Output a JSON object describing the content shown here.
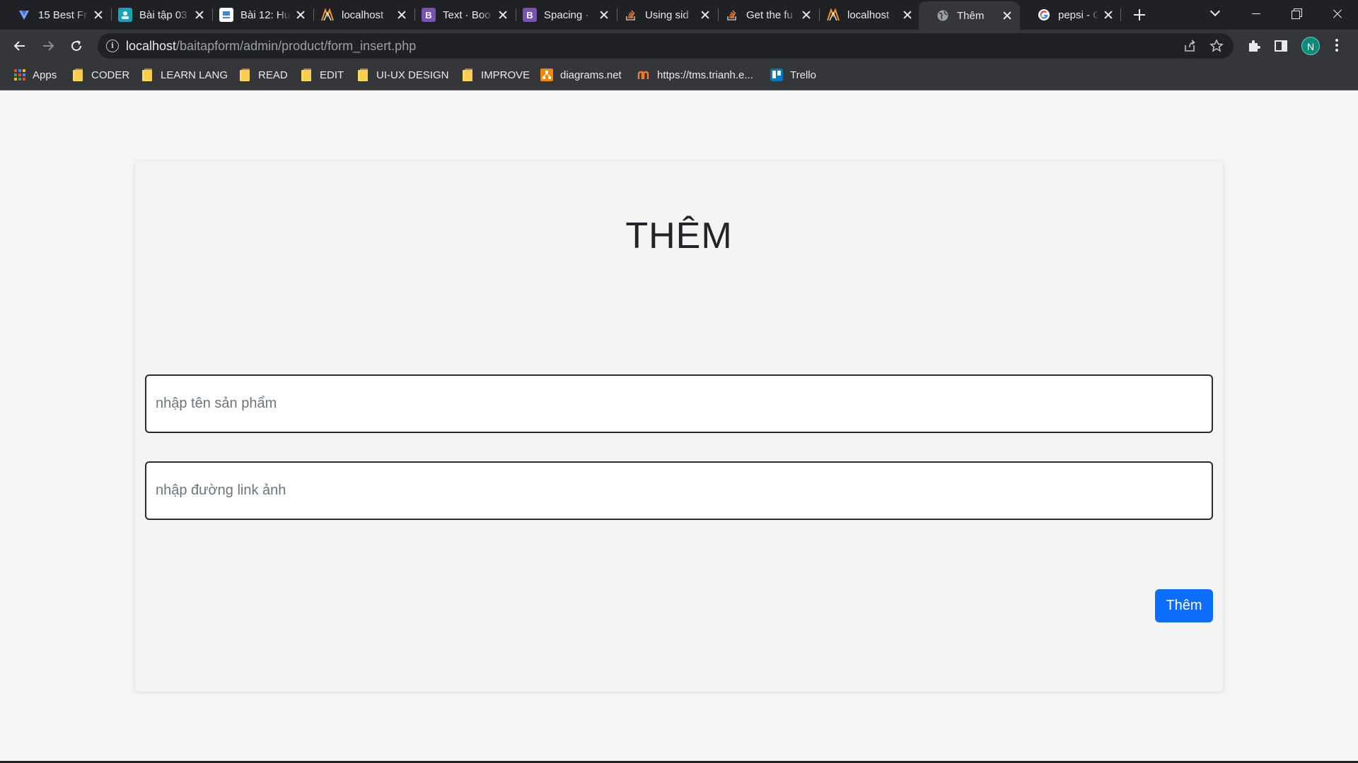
{
  "browser": {
    "tabs": [
      {
        "title": "15 Best Fr",
        "icon": "vscode-blue-icon",
        "active": false
      },
      {
        "title": "Bài tập 03",
        "icon": "classroom-icon",
        "active": false
      },
      {
        "title": "Bài 12: Hư",
        "icon": "doc-icon",
        "active": false
      },
      {
        "title": "localhost",
        "icon": "xampp-icon",
        "active": false
      },
      {
        "title": "Text · Boo",
        "icon": "bootstrap-icon",
        "active": false
      },
      {
        "title": "Spacing ·",
        "icon": "bootstrap-icon",
        "active": false
      },
      {
        "title": "Using sid",
        "icon": "stackoverflow-icon",
        "active": false
      },
      {
        "title": "Get the fu",
        "icon": "stackoverflow-icon",
        "active": false
      },
      {
        "title": "localhost",
        "icon": "xampp-icon",
        "active": false
      },
      {
        "title": "Thêm",
        "icon": "globe-icon",
        "active": true
      },
      {
        "title": "pepsi - G",
        "icon": "google-icon",
        "active": false
      }
    ],
    "url_host": "localhost",
    "url_path": "/baitapform/admin/product/form_insert.php",
    "profile_initial": "N",
    "bookmarks": [
      {
        "label": "Apps",
        "icon": "apps-grid-icon"
      },
      {
        "label": "CODER",
        "icon": "folder-icon"
      },
      {
        "label": "LEARN LANG",
        "icon": "folder-icon"
      },
      {
        "label": "READ",
        "icon": "folder-icon"
      },
      {
        "label": "EDIT",
        "icon": "folder-icon"
      },
      {
        "label": "UI-UX DESIGN",
        "icon": "folder-icon"
      },
      {
        "label": "IMPROVE",
        "icon": "folder-icon"
      },
      {
        "label": "diagrams.net",
        "icon": "drawio-icon"
      },
      {
        "label": "https://tms.trianh.e...",
        "icon": "site-icon"
      },
      {
        "label": "Trello",
        "icon": "trello-icon"
      }
    ]
  },
  "page": {
    "title": "THÊM",
    "product_name_placeholder": "nhập tên sản phẩm",
    "product_name_value": "",
    "image_link_placeholder": "nhập đường link ảnh",
    "image_link_value": "",
    "submit_label": "Thêm"
  },
  "colors": {
    "chrome_dark": "#202124",
    "chrome_toolbar": "#35363a",
    "page_bg": "#f5f5f5",
    "primary_button": "#0d6efd",
    "profile": "#0d8a7a"
  }
}
